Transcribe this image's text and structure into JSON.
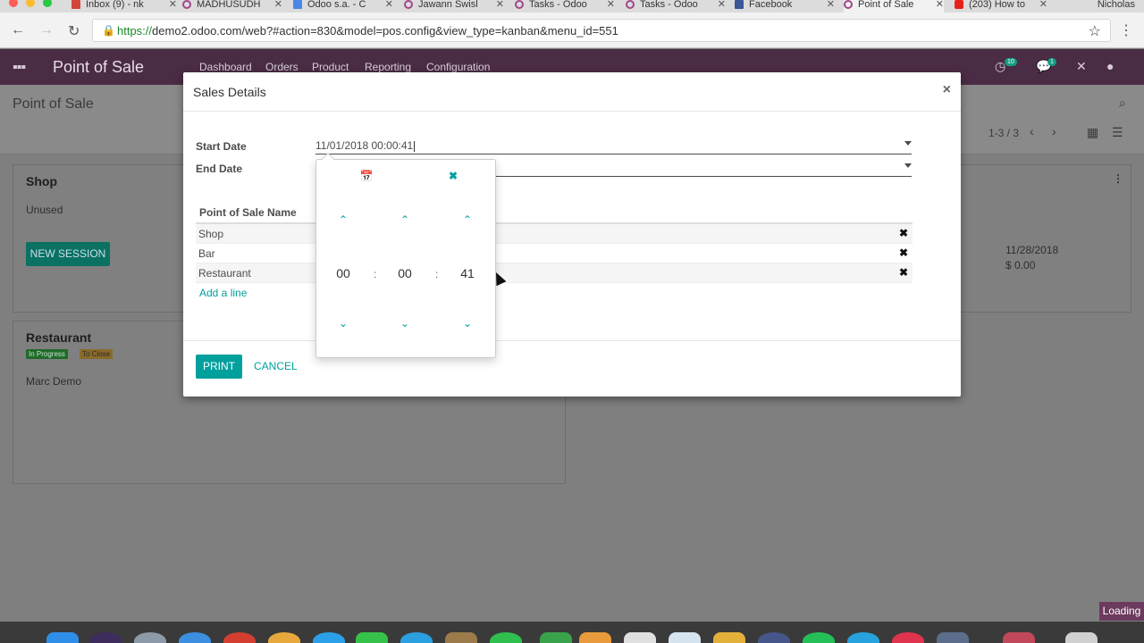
{
  "browser": {
    "tabs": [
      {
        "label": "Inbox (9) - nk",
        "favicon_color": "#d44638",
        "active": false
      },
      {
        "label": "MADHUSUDH",
        "favicon_color": "#a24689",
        "active": false
      },
      {
        "label": "Odoo s.a. - C",
        "favicon_color": "#4a86e8",
        "active": false
      },
      {
        "label": "Jawann Swisl",
        "favicon_color": "#a24689",
        "active": false
      },
      {
        "label": "Tasks - Odoo",
        "favicon_color": "#a24689",
        "active": false
      },
      {
        "label": "Tasks - Odoo",
        "favicon_color": "#a24689",
        "active": false
      },
      {
        "label": "Facebook",
        "favicon_color": "#3b5998",
        "active": false
      },
      {
        "label": "Point of Sale",
        "favicon_color": "#a24689",
        "active": true
      },
      {
        "label": "(203) How to",
        "favicon_color": "#e62117",
        "active": false
      }
    ],
    "profile_name": "Nicholas",
    "url_scheme": "https://",
    "url_rest": "demo2.odoo.com/web?#action=830&model=pos.config&view_type=kanban&menu_id=551"
  },
  "odoo": {
    "app_title": "Point of Sale",
    "menu": [
      "Dashboard",
      "Orders",
      "Product",
      "Reporting",
      "Configuration"
    ],
    "activity_count": "10",
    "message_count": "1",
    "breadcrumb": "Point of Sale",
    "pager": "1-3 / 3",
    "cards": {
      "shop": {
        "title": "Shop",
        "status": "Unused",
        "button": "NEW SESSION",
        "date": "11/28/2018",
        "amount": "$ 0.00"
      },
      "restaurant": {
        "title": "Restaurant",
        "tag1": "In Progress",
        "tag2": "To Close",
        "user": "Marc Demo"
      }
    }
  },
  "modal": {
    "title": "Sales Details",
    "close": "×",
    "start_label": "Start Date",
    "start_value": "11/01/2018 00:00:41",
    "end_label": "End Date",
    "end_value": "",
    "table_header": "Point of Sale Name",
    "rows": [
      "Shop",
      "Bar",
      "Restaurant"
    ],
    "add_line": "Add a line",
    "print": "PRINT",
    "cancel": "CANCEL"
  },
  "picker": {
    "hours": "00",
    "minutes": "00",
    "seconds": "41",
    "separator": ":"
  },
  "status": {
    "loading": "Loading"
  },
  "colors": {
    "accent": "#00a09d",
    "navbar": "#4b2c45"
  }
}
